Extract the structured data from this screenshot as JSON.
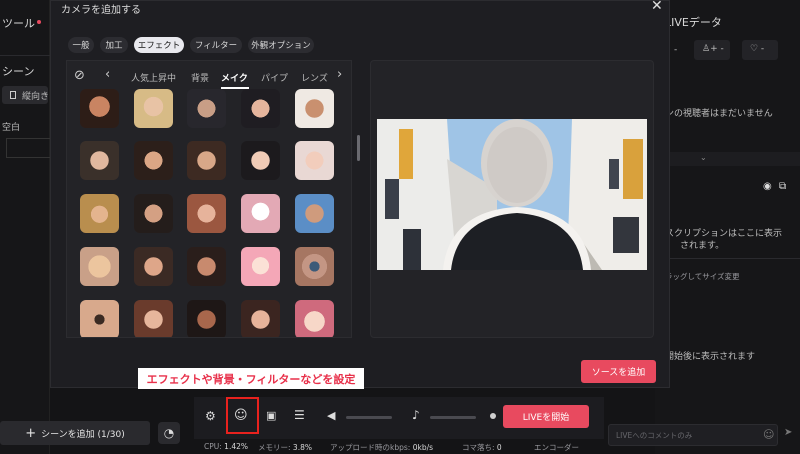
{
  "background": {
    "left_title": "ツール",
    "scene_label": "シーン",
    "portrait_label": "縦向き",
    "blank_label": "空白",
    "add_scene_label": "シーンを追加 (1/30)",
    "right_title": "LIVEデータ",
    "viewers_text": "ンの視聴者はまだいません",
    "sub_text_1": "スクリプションはここに表示",
    "sub_text_2": "されます。",
    "resize_hint": "ラッグしてサイズ変更",
    "start_hint": "開始後に表示されます",
    "comment_placeholder": "LIVEへのコメントのみ"
  },
  "modal": {
    "title": "カメラを追加する",
    "tabs": [
      "一般",
      "加工",
      "エフェクト",
      "フィルター",
      "外観オプション"
    ],
    "active_tab": "エフェクト",
    "categories": [
      "人気上昇中",
      "背景",
      "メイク",
      "パイプ",
      "レンズ"
    ],
    "active_category": "メイク",
    "add_source_label": "ソースを追加"
  },
  "annotation": {
    "text": "エフェクトや背景・フィルターなどを設定"
  },
  "toolbar": {
    "start_live_label": "LIVEを開始"
  },
  "status": {
    "cpu_label": "CPU:",
    "cpu_value": "1.42%",
    "memory_label": "メモリー:",
    "memory_value": "3.8%",
    "upload_label": "アップロード時のkbps:",
    "upload_value": "0kb/s",
    "frames_label": "コマ落ち:",
    "frames_value": "0",
    "encoder_label": "エンコーダー"
  },
  "colors": {
    "accent": "#e84a5f",
    "annotation_box": "#e8221e"
  }
}
